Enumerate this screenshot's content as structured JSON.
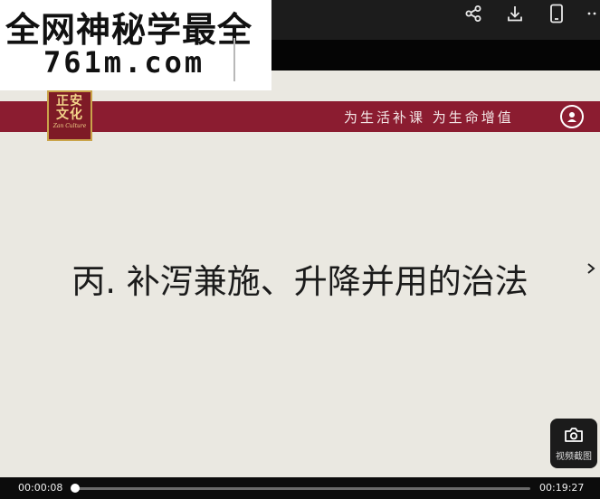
{
  "watermark": {
    "line1": "全网神秘学最全",
    "line2": "761m.com"
  },
  "slide": {
    "logo": {
      "line1": "正安",
      "line2": "文化",
      "subtitle": "Zan Culture"
    },
    "slogan": "为生活补课 为生命增值",
    "title": "丙. 补泻兼施、升降并用的治法"
  },
  "toolbar": {
    "share_icon": "share-icon",
    "download_icon": "download-icon",
    "phone_icon": "phone-icon",
    "more_icon": "more-icon"
  },
  "capture": {
    "label": "视频截图",
    "icon": "camera-icon"
  },
  "player": {
    "current_time": "00:00:08",
    "duration": "00:19:27",
    "progress": 0.0069
  },
  "colors": {
    "header_red": "#8b1c30",
    "slide_bg": "#eae8e1",
    "logo_gold": "#caa44a"
  }
}
